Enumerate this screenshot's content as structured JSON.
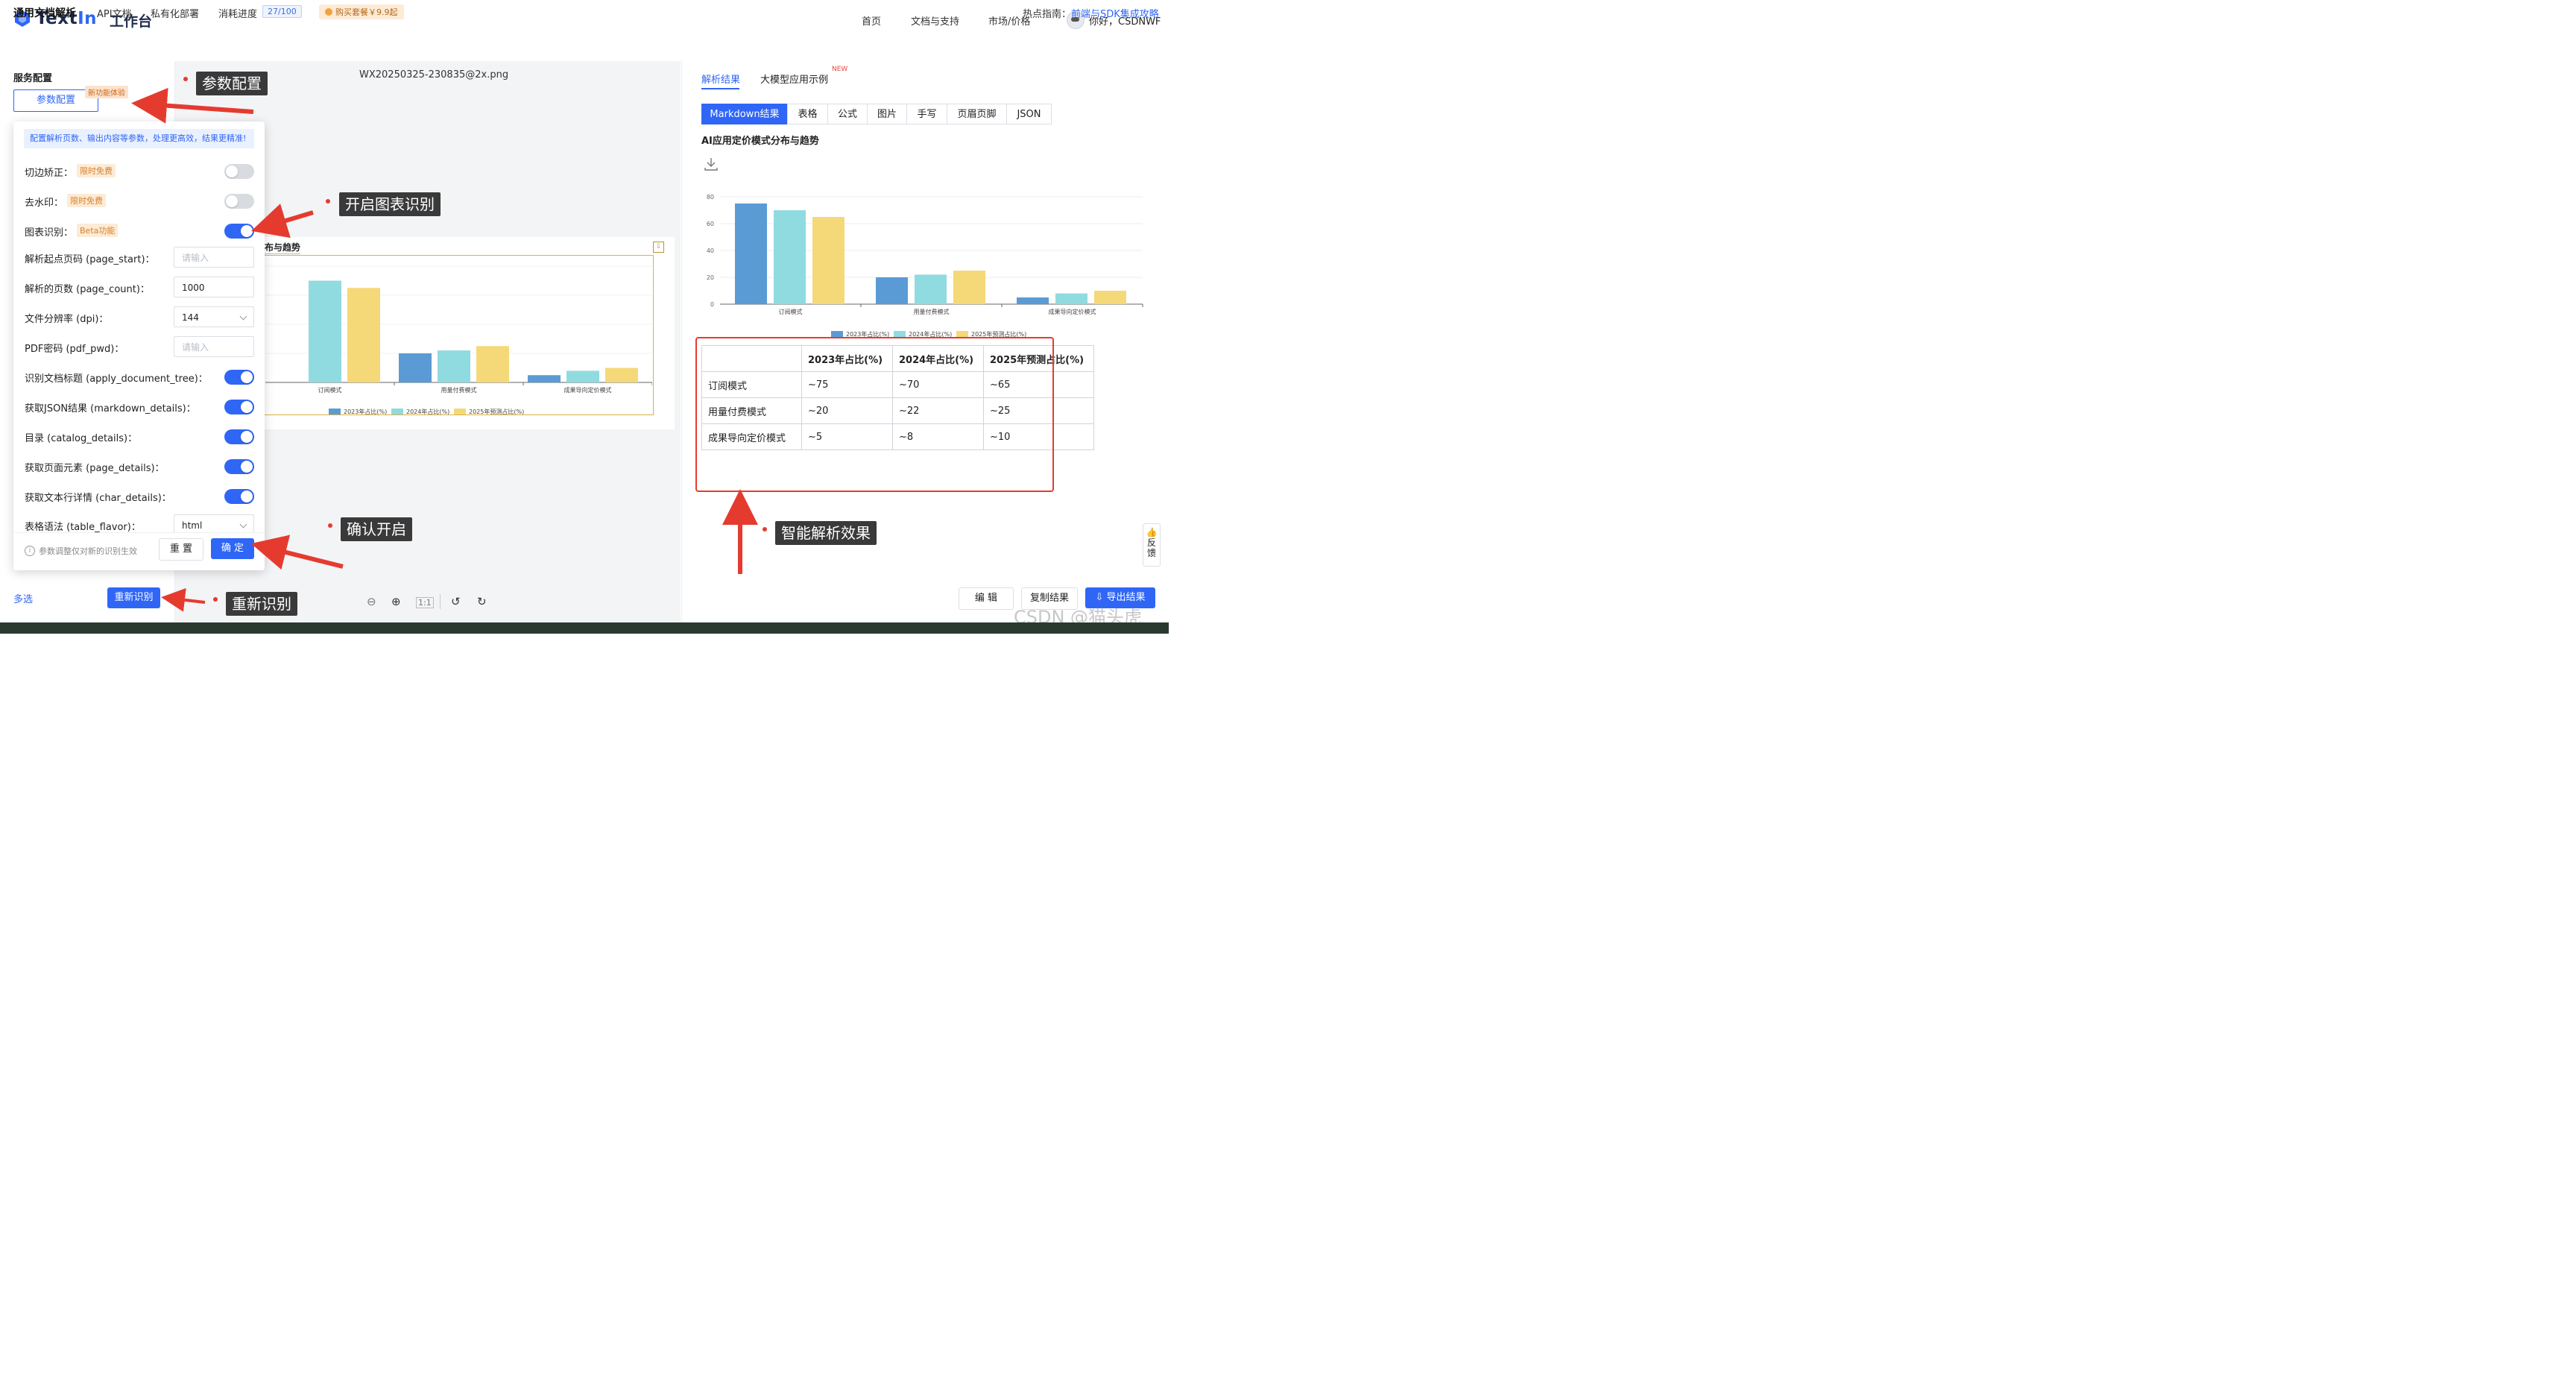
{
  "header": {
    "logo_text": "TextIn",
    "workbench": "工作台",
    "nav": [
      "首页",
      "文档与支持",
      "市场/价格"
    ],
    "user_greeting": "你好，CSDNWF"
  },
  "subnav": {
    "items": [
      "通用文档解析",
      "API文档",
      "私有化部署",
      "消耗进度"
    ],
    "progress": "27/100",
    "buy": "购买套餐￥9.9起",
    "hot_label": "热点指南：",
    "hot_link": "前端与SDK集成攻略"
  },
  "left": {
    "title": "服务配置",
    "param_button": "参数配置",
    "new_tag": "新功能体验",
    "multi_select": "多选",
    "recognize_button": "重新识别"
  },
  "popup": {
    "hint": "配置解析页数、输出内容等参数，处理更高效，结果更精准!",
    "rows": [
      {
        "label": "切边矫正：",
        "tag": "限时免费",
        "type": "toggle",
        "on": false
      },
      {
        "label": "去水印：",
        "tag": "限时免费",
        "type": "toggle",
        "on": false
      },
      {
        "label": "图表识别：",
        "tag": "Beta功能",
        "type": "toggle",
        "on": true
      },
      {
        "label": "解析起点页码 (page_start)：",
        "type": "input",
        "value": "",
        "placeholder": "请输入"
      },
      {
        "label": "解析的页数 (page_count)：",
        "type": "input",
        "value": "1000"
      },
      {
        "label": "文件分辨率 (dpi)：",
        "type": "select",
        "value": "144"
      },
      {
        "label": "PDF密码 (pdf_pwd)：",
        "type": "input",
        "value": "",
        "placeholder": "请输入"
      },
      {
        "label": "识别文档标题 (apply_document_tree)：",
        "type": "toggle",
        "on": true
      },
      {
        "label": "获取JSON结果 (markdown_details)：",
        "type": "toggle",
        "on": true
      },
      {
        "label": "目录 (catalog_details)：",
        "type": "toggle",
        "on": true
      },
      {
        "label": "获取页面元素 (page_details)：",
        "type": "toggle",
        "on": true
      },
      {
        "label": "获取文本行详情 (char_details)：",
        "type": "toggle",
        "on": true
      },
      {
        "label": "表格语法 (table_flavor)：",
        "type": "select",
        "value": "html"
      }
    ],
    "footer_note": "参数调整仅对新的识别生效",
    "reset": "重 置",
    "ok": "确 定"
  },
  "center": {
    "filename": "WX20250325-230835@2x.png",
    "doc_title": "布与趋势"
  },
  "right": {
    "tabs": [
      "解析结果",
      "大模型应用示例"
    ],
    "new_label": "NEW",
    "segments": [
      "Markdown结果",
      "表格",
      "公式",
      "图片",
      "手写",
      "页眉页脚",
      "JSON"
    ],
    "chart_title": "AI应用定价模式分布与趋势",
    "table": {
      "headers": [
        "",
        "2023年占比(%)",
        "2024年占比(%)",
        "2025年预测占比(%)"
      ],
      "rows": [
        [
          "订阅模式",
          "~75",
          "~70",
          "~65"
        ],
        [
          "用量付费模式",
          "~20",
          "~22",
          "~25"
        ],
        [
          "成果导向定价模式",
          "~5",
          "~8",
          "~10"
        ]
      ]
    },
    "buttons": {
      "edit": "编 辑",
      "copy": "复制结果",
      "export": "导出结果"
    },
    "feedback": "反馈",
    "watermark": "CSDN @猫头虎"
  },
  "callouts": [
    "参数配置",
    "开启图表识别",
    "确认开启",
    "智能解析效果",
    "重新识别"
  ],
  "colors": {
    "accent": "#2f66f6",
    "s2023": "#5b9bd5",
    "s2024": "#8fdbe0",
    "s2025": "#f5d978",
    "red": "#e53b2f"
  },
  "chart_data": [
    {
      "type": "bar",
      "categories": [
        "订阅模式",
        "用量付费模式",
        "成果导向定价模式"
      ],
      "series": [
        {
          "name": "2023年占比(%)",
          "values": [
            75,
            20,
            5
          ]
        },
        {
          "name": "2024年占比(%)",
          "values": [
            70,
            22,
            8
          ]
        },
        {
          "name": "2025年预测占比(%)",
          "values": [
            65,
            25,
            10
          ]
        }
      ],
      "ylim": [
        0,
        80
      ],
      "yticks": [
        0,
        20,
        40,
        60,
        80
      ],
      "legend": "bottom"
    }
  ]
}
